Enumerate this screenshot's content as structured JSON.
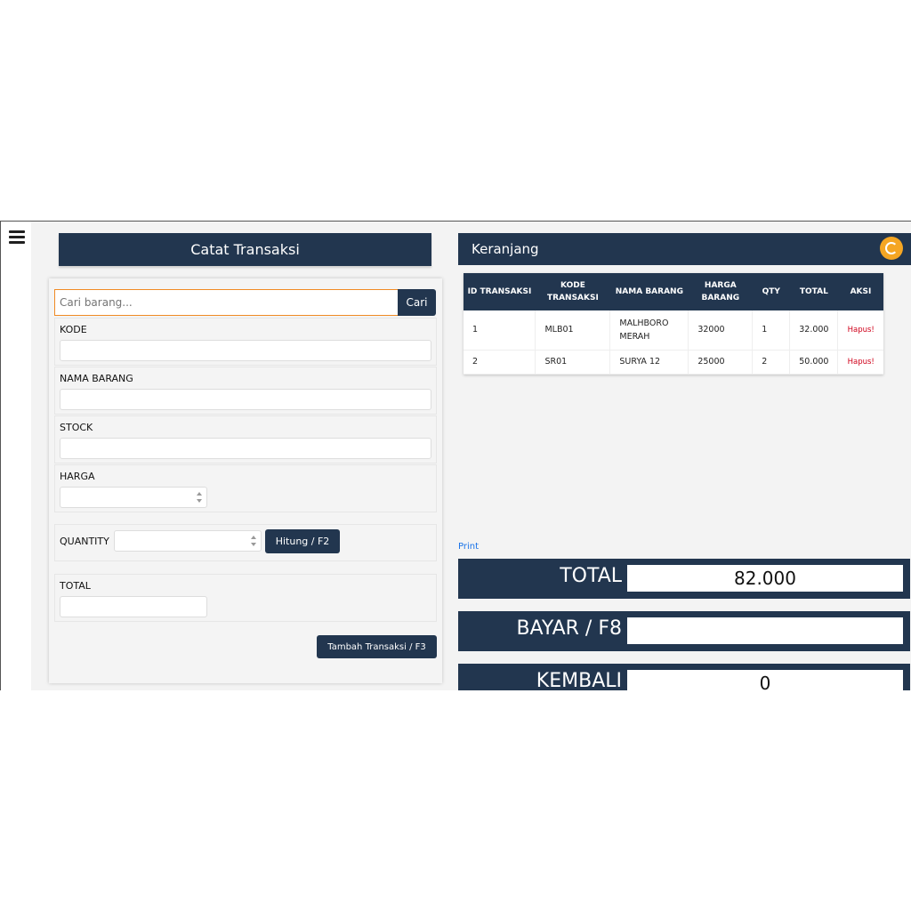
{
  "left_panel": {
    "title": "Catat Transaksi",
    "search": {
      "placeholder": "Cari barang...",
      "value": "",
      "button": "Cari"
    },
    "fields": {
      "kode": {
        "label": "KODE",
        "value": ""
      },
      "nama": {
        "label": "NAMA BARANG",
        "value": ""
      },
      "stock": {
        "label": "STOCK",
        "value": ""
      },
      "harga": {
        "label": "HARGA",
        "value": ""
      }
    },
    "quantity": {
      "label": "QUANTITY",
      "value": "",
      "button": "Hitung / F2"
    },
    "total": {
      "label": "TOTAL",
      "value": ""
    },
    "submit_button": "Tambah Transaksi / F3"
  },
  "right_panel": {
    "title": "Keranjang",
    "columns": [
      "ID TRANSAKSI",
      "KODE TRANSAKSI",
      "NAMA BARANG",
      "HARGA BARANG",
      "QTY",
      "TOTAL",
      "AKSI"
    ],
    "rows": [
      {
        "id": "1",
        "kode": "MLB01",
        "nama": "MALHBORO MERAH",
        "harga": "32000",
        "qty": "1",
        "total": "32.000",
        "aksi": "Hapus!"
      },
      {
        "id": "2",
        "kode": "SR01",
        "nama": "SURYA 12",
        "harga": "25000",
        "qty": "2",
        "total": "50.000",
        "aksi": "Hapus!"
      }
    ],
    "print_link": "Print",
    "summary": {
      "total": {
        "label": "TOTAL",
        "value": "82.000"
      },
      "bayar": {
        "label": "BAYAR / F8",
        "value": ""
      },
      "kembali": {
        "label": "KEMBALI",
        "value": "0"
      }
    }
  },
  "colors": {
    "primary": "#22364f",
    "accent": "#f5a623",
    "danger": "#d0021b",
    "link": "#1a73e8"
  }
}
